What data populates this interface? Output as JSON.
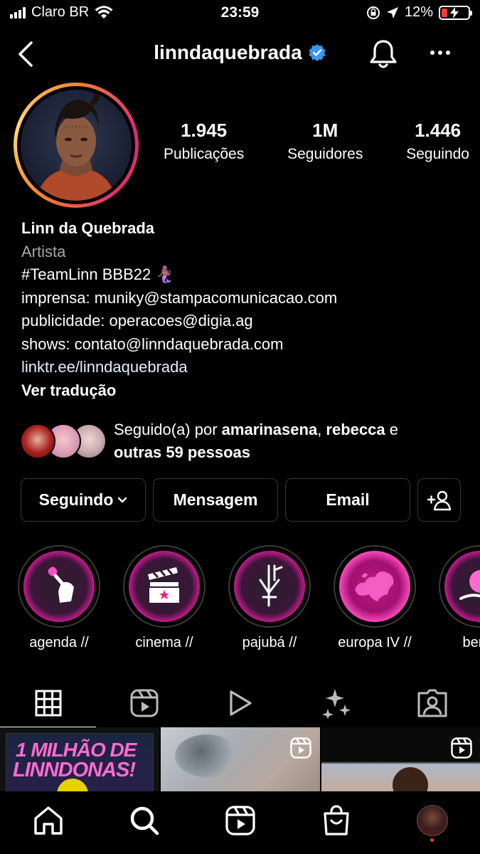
{
  "status_bar": {
    "carrier": "Claro BR",
    "time": "23:59",
    "battery": "12%",
    "battery_level": 0.12
  },
  "header": {
    "username": "linndaquebrada",
    "verified": true
  },
  "profile": {
    "stats": [
      {
        "value": "1.945",
        "label": "Publicações"
      },
      {
        "value": "1M",
        "label": "Seguidores"
      },
      {
        "value": "1.446",
        "label": "Seguindo"
      }
    ],
    "name": "Linn da Quebrada",
    "category": "Artista",
    "bio_lines": [
      "#TeamLinn BBB22 🧜🏾‍♀️",
      "imprensa: muniky@stampacomunicacao.com",
      "publicidade: operacoes@digia.ag",
      "shows: contato@linndaquebrada.com"
    ],
    "link": "linktr.ee/linndaquebrada",
    "translate": "Ver tradução"
  },
  "followed_by": {
    "prefix": "Seguido(a) por ",
    "user1": "amarinasena",
    "sep": ", ",
    "user2": "rebecca",
    "mid": " e",
    "others": "outras 59 pessoas"
  },
  "actions": {
    "following": "Seguindo",
    "message": "Mensagem",
    "email": "Email"
  },
  "highlights": [
    {
      "label": "agenda //",
      "icon": "microphone-fist-icon"
    },
    {
      "label": "cinema //",
      "icon": "clapperboard-icon"
    },
    {
      "label": "pajubá //",
      "icon": "symbol-icon"
    },
    {
      "label": "europa IV //",
      "icon": "europe-map-icon"
    },
    {
      "label": "berlin",
      "icon": "globe-hand-icon"
    }
  ],
  "tabs": [
    "grid-icon",
    "reels-icon",
    "video-icon",
    "effects-icon",
    "tagged-icon"
  ],
  "grid": {
    "tile1_text_line1": "1 MILHÃO DE",
    "tile1_text_line2": "LINNDONAS!"
  },
  "bottom_nav": [
    "home-icon",
    "search-icon",
    "reels-icon",
    "shop-icon",
    "profile-avatar"
  ],
  "colors": {
    "verified": "#3897f0",
    "accent": "#e91e8c",
    "notification": "#ff3040"
  }
}
